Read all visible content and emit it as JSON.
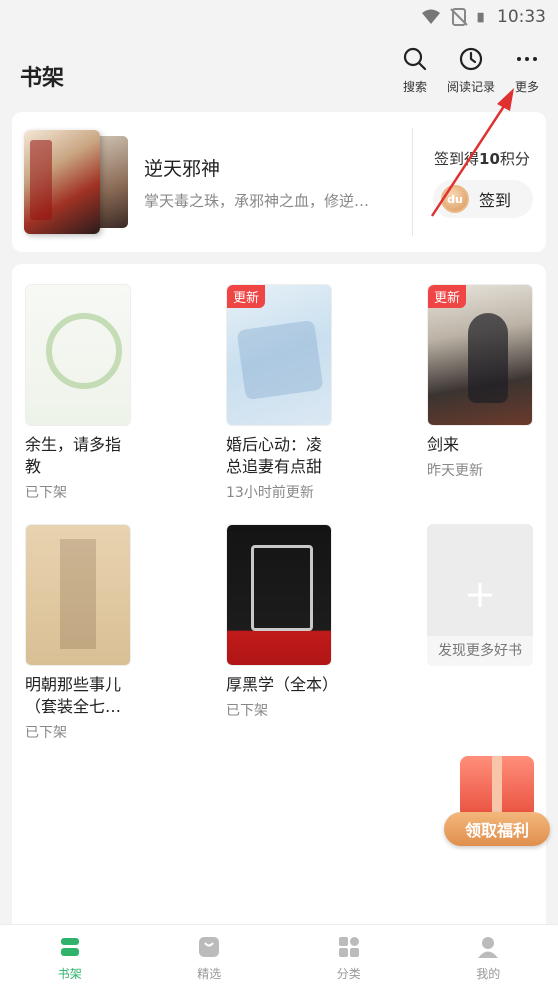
{
  "status_bar": {
    "time": "10:33"
  },
  "header": {
    "title": "书架",
    "actions": [
      {
        "label": "搜索",
        "icon": "search-icon"
      },
      {
        "label": "阅读记录",
        "icon": "clock-icon"
      },
      {
        "label": "更多",
        "icon": "more-icon"
      }
    ]
  },
  "recent": {
    "title": "逆天邪神",
    "description": "掌天毒之珠，承邪神之血，修逆…",
    "signin_text_prefix": "签到得",
    "signin_points": "10",
    "signin_text_suffix": "积分",
    "signin_button": "签到",
    "coin_text": "du"
  },
  "shelf": {
    "books": [
      {
        "title": "余生，请多指教",
        "status": "已下架",
        "badge": ""
      },
      {
        "title": "婚后心动：凌总追妻有点甜",
        "status": "13小时前更新",
        "badge": "更新"
      },
      {
        "title": "剑来",
        "status": "昨天更新",
        "badge": "更新"
      },
      {
        "title": "明朝那些事儿（套装全七…",
        "status": "已下架",
        "badge": ""
      },
      {
        "title": "厚黑学（全本）",
        "status": "已下架",
        "badge": ""
      }
    ],
    "add_more": {
      "label": "发现更多好书",
      "icon": "plus-icon"
    }
  },
  "welfare": {
    "label": "领取福利"
  },
  "tabs": [
    {
      "label": "书架",
      "icon": "bookshelf-icon",
      "active": true
    },
    {
      "label": "精选",
      "icon": "bag-icon",
      "active": false
    },
    {
      "label": "分类",
      "icon": "category-icon",
      "active": false
    },
    {
      "label": "我的",
      "icon": "user-icon",
      "active": false
    }
  ],
  "colors": {
    "accent": "#2fb36b",
    "badge": "#ef4545",
    "annotation_arrow": "#e03030"
  }
}
